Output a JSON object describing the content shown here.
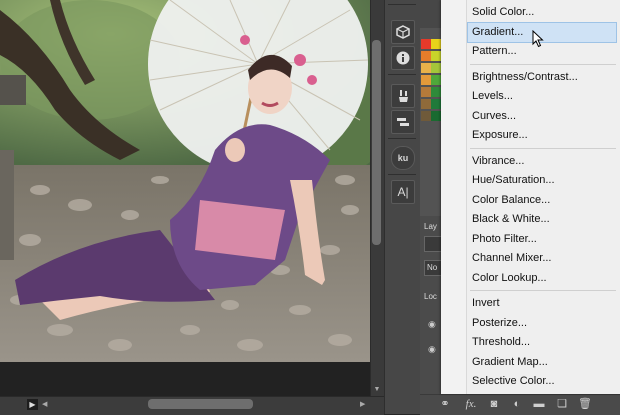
{
  "adjustment_menu": {
    "groups": [
      [
        "Solid Color...",
        "Gradient...",
        "Pattern..."
      ],
      [
        "Brightness/Contrast...",
        "Levels...",
        "Curves...",
        "Exposure..."
      ],
      [
        "Vibrance...",
        "Hue/Saturation...",
        "Color Balance...",
        "Black & White...",
        "Photo Filter...",
        "Channel Mixer...",
        "Color Lookup..."
      ],
      [
        "Invert",
        "Posterize...",
        "Threshold...",
        "Gradient Map...",
        "Selective Color..."
      ]
    ],
    "highlighted": "Gradient..."
  },
  "layers_fragment": {
    "tab_label": "Lay",
    "blend_label": "No",
    "lock_label": "Loc"
  },
  "toolbar_icons": [
    "cube-icon",
    "info-icon",
    "brush-presets-icon",
    "tool-presets-icon",
    "kuler-icon",
    "character-icon"
  ],
  "toolbar_labels": {
    "kuler": "ku",
    "character": "A|"
  },
  "bottom_bar": {
    "fx_label": "fx."
  },
  "colors": {
    "menu_highlight": "#cfe2f5",
    "panel_bg": "#535353",
    "toolbar_bg": "#474747"
  }
}
